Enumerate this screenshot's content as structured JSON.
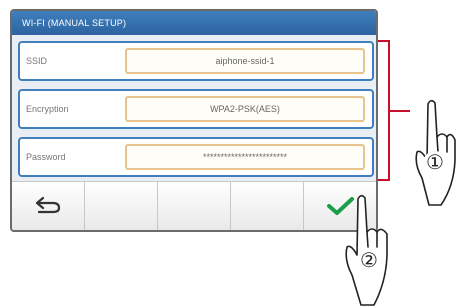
{
  "screen": {
    "title": "WI-FI (MANUAL SETUP)",
    "fields": [
      {
        "label": "SSID",
        "value": "aiphone-ssid-1"
      },
      {
        "label": "Encryption",
        "value": "WPA2-PSK(AES)"
      },
      {
        "label": "Password",
        "value": "************************"
      }
    ]
  },
  "toolbar": {
    "buttons": [
      "back-icon",
      "",
      "",
      "",
      "check-icon"
    ]
  },
  "callouts": {
    "step1": "①",
    "step2": "②"
  },
  "colors": {
    "accent": "#3f7fbd",
    "field_border": "#e7c58c",
    "check": "#1a9e4a",
    "bracket": "#c8102e"
  }
}
